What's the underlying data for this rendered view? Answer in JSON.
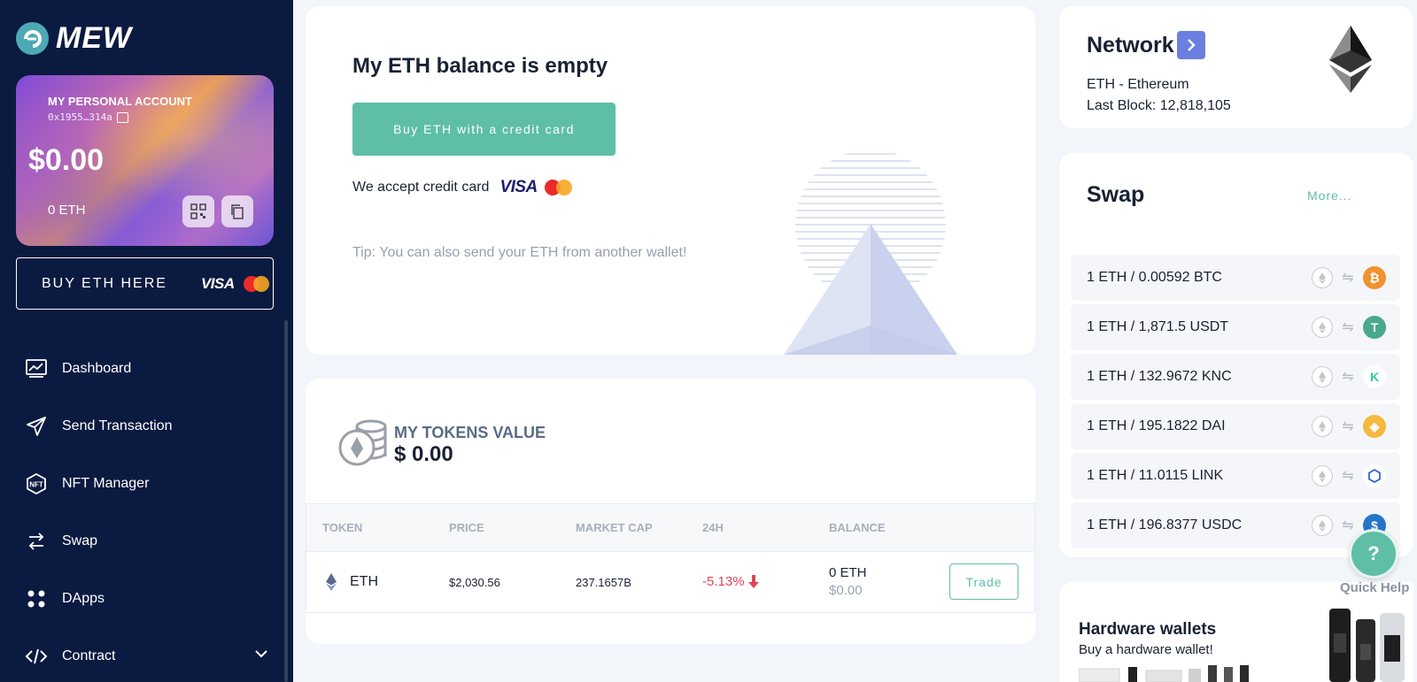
{
  "app": {
    "logo_text": "MEW"
  },
  "account": {
    "name": "MY PERSONAL ACCOUNT",
    "address": "0x1955…314a",
    "balance_usd": "$0.00",
    "balance_eth": "0 ETH"
  },
  "buy_eth_button": {
    "label": "BUY ETH HERE",
    "visa": "VISA"
  },
  "nav": {
    "items": [
      {
        "label": "Dashboard",
        "icon": "chart-icon"
      },
      {
        "label": "Send Transaction",
        "icon": "paper-plane-icon"
      },
      {
        "label": "NFT Manager",
        "icon": "nft-icon"
      },
      {
        "label": "Swap",
        "icon": "swap-icon"
      },
      {
        "label": "DApps",
        "icon": "grid-dots-icon"
      },
      {
        "label": "Contract",
        "icon": "code-icon"
      }
    ]
  },
  "balance_panel": {
    "title": "My ETH balance is empty",
    "buy_button": "Buy ETH with a credit card",
    "accept_text": "We accept credit card",
    "visa": "VISA",
    "tip": "Tip: You can also send your ETH from another wallet!"
  },
  "tokens": {
    "label": "MY TOKENS VALUE",
    "value": "$ 0.00",
    "columns": [
      "TOKEN",
      "PRICE",
      "MARKET CAP",
      "24H",
      "BALANCE"
    ],
    "rows": [
      {
        "token": "ETH",
        "price": "$2,030.56",
        "market_cap": "237.1657B",
        "change": "-5.13%",
        "balance": "0 ETH",
        "balance_usd": "$0.00",
        "action": "Trade"
      }
    ]
  },
  "network": {
    "title": "Network",
    "name": "ETH - Ethereum",
    "last_block": "Last Block: 12,818,105"
  },
  "swap": {
    "title": "Swap",
    "more": "More...",
    "pairs": [
      {
        "label": "1 ETH / 0.00592 BTC",
        "token_icon": "btc-icon",
        "color": "#f0922f",
        "glyph": "₿"
      },
      {
        "label": "1 ETH / 1,871.5 USDT",
        "token_icon": "usdt-icon",
        "color": "#4aa98a",
        "glyph": "T"
      },
      {
        "label": "1 ETH / 132.9672 KNC",
        "token_icon": "knc-icon",
        "color": "#31cb9e",
        "glyph": "K"
      },
      {
        "label": "1 ETH / 195.1822 DAI",
        "token_icon": "dai-icon",
        "color": "#f5b840",
        "glyph": "◈"
      },
      {
        "label": "1 ETH / 11.0115 LINK",
        "token_icon": "link-icon",
        "color": "#2a5ada",
        "glyph": "⬡"
      },
      {
        "label": "1 ETH / 196.8377 USDC",
        "token_icon": "usdc-icon",
        "color": "#2775ca",
        "glyph": "$"
      }
    ]
  },
  "hardware": {
    "title": "Hardware wallets",
    "subtitle": "Buy a hardware wallet!"
  },
  "quick_help": {
    "glyph": "?",
    "label": "Quick Help"
  },
  "colors": {
    "sidebar": "#0b1a40",
    "accent": "#5ebfa6",
    "negative": "#e0445a",
    "network_arrow": "#6b7fe0"
  }
}
